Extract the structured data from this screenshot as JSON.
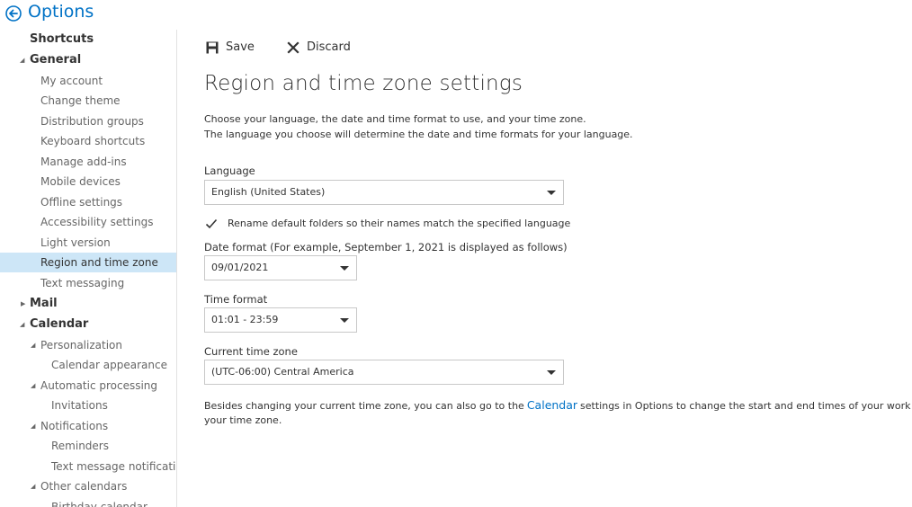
{
  "header": {
    "title": "Options"
  },
  "sidebar": {
    "items": [
      {
        "label": "Shortcuts"
      },
      {
        "label": "General"
      },
      {
        "label": "My account"
      },
      {
        "label": "Change theme"
      },
      {
        "label": "Distribution groups"
      },
      {
        "label": "Keyboard shortcuts"
      },
      {
        "label": "Manage add-ins"
      },
      {
        "label": "Mobile devices"
      },
      {
        "label": "Offline settings"
      },
      {
        "label": "Accessibility settings"
      },
      {
        "label": "Light version"
      },
      {
        "label": "Region and time zone"
      },
      {
        "label": "Text messaging"
      },
      {
        "label": "Mail"
      },
      {
        "label": "Calendar"
      },
      {
        "label": "Personalization"
      },
      {
        "label": "Calendar appearance"
      },
      {
        "label": "Automatic processing"
      },
      {
        "label": "Invitations"
      },
      {
        "label": "Notifications"
      },
      {
        "label": "Reminders"
      },
      {
        "label": "Text message notifications"
      },
      {
        "label": "Other calendars"
      },
      {
        "label": "Birthday calendar"
      }
    ]
  },
  "toolbar": {
    "save_label": "Save",
    "discard_label": "Discard"
  },
  "main": {
    "title": "Region and time zone settings",
    "description_line1": "Choose your language, the date and time format to use, and your time zone.",
    "description_line2": "The language you choose will determine the date and time formats for your language.",
    "language_label": "Language",
    "language_value": "English (United States)",
    "rename_checkbox_label": "Rename default folders so their names match the specified language",
    "rename_checked": true,
    "date_format_label": "Date format (For example, September 1, 2021 is displayed as follows)",
    "date_format_value": "09/01/2021",
    "time_format_label": "Time format",
    "time_format_value": "01:01 - 23:59",
    "time_zone_label": "Current time zone",
    "time_zone_value": "(UTC-06:00) Central America",
    "footer_before": "Besides changing your current time zone, you can also go to the",
    "footer_link": "Calendar",
    "footer_after": "settings in Options to change the start and end times of your work week",
    "footer_line2": "your time zone."
  },
  "colors": {
    "accent": "#0072c6",
    "selected_bg": "#cde6f7"
  },
  "icons": [
    "back-arrow-icon",
    "save-icon",
    "discard-icon",
    "chevron-down-icon",
    "checkmark-icon",
    "triangle-expanded-icon",
    "triangle-collapsed-icon"
  ]
}
